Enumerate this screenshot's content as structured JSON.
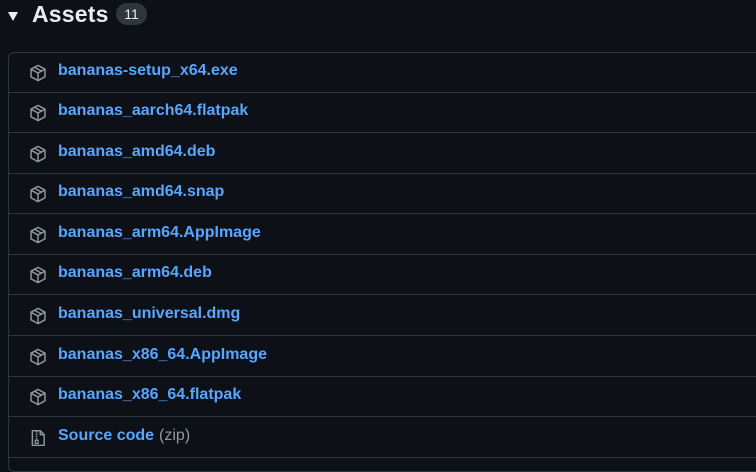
{
  "header": {
    "title": "Assets",
    "count": "11"
  },
  "assets": [
    {
      "name": "bananas-setup_x64.exe",
      "icon": "package-icon"
    },
    {
      "name": "bananas_aarch64.flatpak",
      "icon": "package-icon"
    },
    {
      "name": "bananas_amd64.deb",
      "icon": "package-icon"
    },
    {
      "name": "bananas_amd64.snap",
      "icon": "package-icon"
    },
    {
      "name": "bananas_arm64.AppImage",
      "icon": "package-icon"
    },
    {
      "name": "bananas_arm64.deb",
      "icon": "package-icon"
    },
    {
      "name": "bananas_universal.dmg",
      "icon": "package-icon"
    },
    {
      "name": "bananas_x86_64.AppImage",
      "icon": "package-icon"
    },
    {
      "name": "bananas_x86_64.flatpak",
      "icon": "package-icon"
    }
  ],
  "source": {
    "label": "Source code",
    "suffix": "(zip)",
    "icon": "file-zip-icon"
  },
  "colors": {
    "background": "#0d1117",
    "link": "#58a6ff",
    "text": "#e6edf3",
    "muted": "#9198a1",
    "border": "#30363d"
  }
}
